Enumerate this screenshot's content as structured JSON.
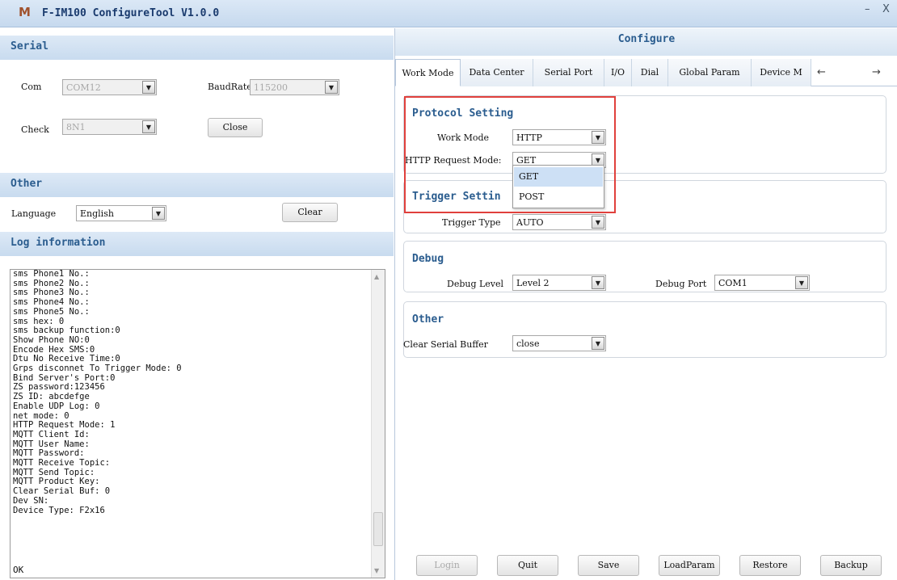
{
  "window": {
    "title": "F-IM100 ConfigureTool V1.0.0",
    "minimize_glyph": "–",
    "close_glyph": "X"
  },
  "serial": {
    "heading": "Serial",
    "com_label": "Com",
    "com_value": "COM12",
    "baud_label": "BaudRate",
    "baud_value": "115200",
    "check_label": "Check",
    "check_value": "8N1",
    "close_button": "Close"
  },
  "other_left": {
    "heading": "Other",
    "language_label": "Language",
    "language_value": "English",
    "clear_button": "Clear"
  },
  "log": {
    "heading": "Log information",
    "lines": [
      "sms Phone1 No.:",
      "sms Phone2 No.:",
      "sms Phone3 No.:",
      "sms Phone4 No.:",
      "sms Phone5 No.:",
      "sms hex: 0",
      "sms backup function:0",
      "Show Phone NO:0",
      "Encode Hex SMS:0",
      "Dtu No Receive Time:0",
      "Grps disconnet To Trigger Mode: 0",
      "Bind Server's Port:0",
      "ZS password:123456",
      "ZS ID: abcdefge",
      "Enable UDP Log: 0",
      "net mode: 0",
      "HTTP Request Mode: 1",
      "MQTT Client Id:",
      "MQTT User Name:",
      "MQTT Password:",
      "MQTT Receive Topic:",
      "MQTT Send Topic:",
      "MQTT Product Key:",
      "Clear Serial Buf: 0",
      "Dev SN:",
      "Device Type: F2x16"
    ],
    "last_line": "OK"
  },
  "configure": {
    "heading": "Configure",
    "tabs": [
      "Work Mode",
      "Data Center",
      "Serial Port",
      "I/O",
      "Dial",
      "Global Param",
      "Device M"
    ],
    "prev_arrow": "←",
    "next_arrow": "→",
    "protocol": {
      "title": "Protocol Setting",
      "work_mode_label": "Work Mode",
      "work_mode_value": "HTTP",
      "http_mode_label": "HTTP Request Mode:",
      "http_mode_value": "GET",
      "dropdown_options": [
        "GET",
        "POST"
      ],
      "dropdown_selected": "GET"
    },
    "trigger": {
      "title": "Trigger Settin",
      "type_label": "Trigger Type",
      "type_value": "AUTO"
    },
    "debug": {
      "title": "Debug",
      "level_label": "Debug Level",
      "level_value": "Level 2",
      "port_label": "Debug Port",
      "port_value": "COM1"
    },
    "other": {
      "title": "Other",
      "clear_buffer_label": "Clear Serial Buffer",
      "clear_buffer_value": "close"
    }
  },
  "footer_buttons": {
    "login": "Login",
    "quit": "Quit",
    "save": "Save",
    "load": "LoadParam",
    "restore": "Restore",
    "backup": "Backup"
  },
  "colors": {
    "accent": "#2b5d8f",
    "highlight_box": "#e0403c",
    "titlebar": "#c6d9ee"
  }
}
